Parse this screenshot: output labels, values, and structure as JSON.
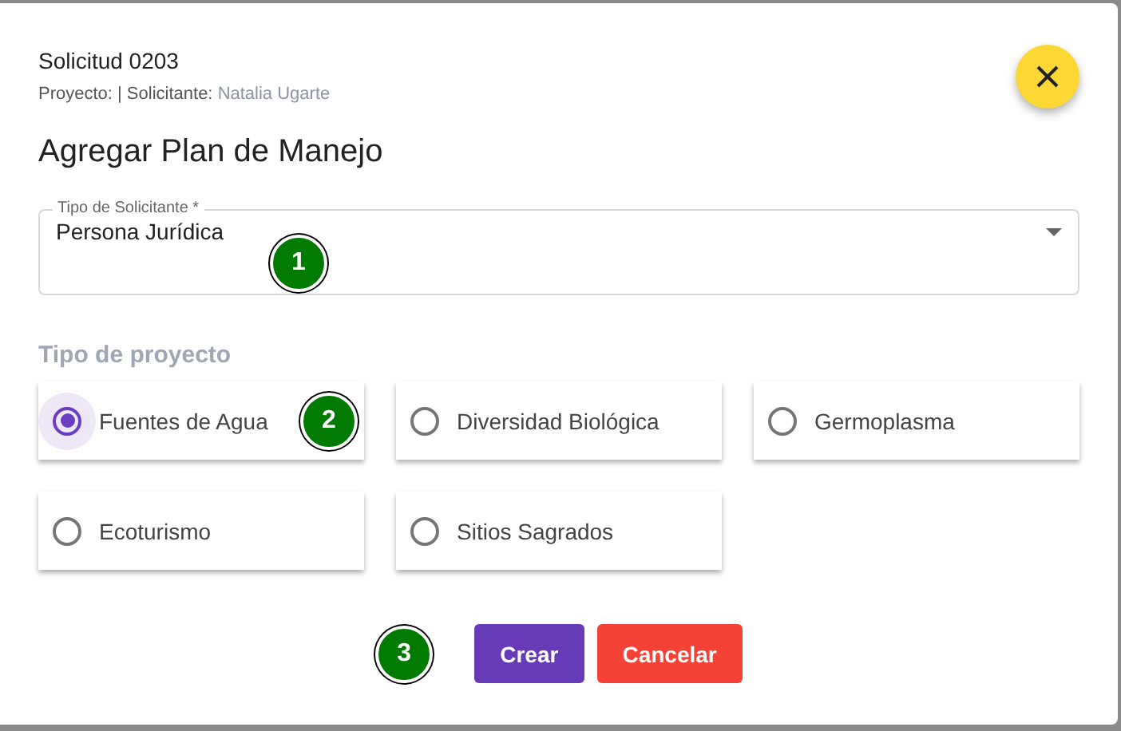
{
  "dialog": {
    "request": "Solicitud 0203",
    "meta_prefix": "Proyecto: | Solicitante:",
    "applicant": "Natalia Ugarte",
    "title": "Agregar Plan de Manejo"
  },
  "select": {
    "label": "Tipo de Solicitante *",
    "value": "Persona Jurídica",
    "badge": "1"
  },
  "project_type": {
    "heading": "Tipo de proyecto",
    "options": [
      {
        "label": "Fuentes de Agua",
        "selected": true,
        "badge": "2"
      },
      {
        "label": "Diversidad Biológica",
        "selected": false
      },
      {
        "label": "Germoplasma",
        "selected": false
      },
      {
        "label": "Ecoturismo",
        "selected": false
      },
      {
        "label": "Sitios Sagrados",
        "selected": false
      }
    ]
  },
  "actions": {
    "badge": "3",
    "buttons": [
      {
        "label": "Crear",
        "kind": "primary"
      },
      {
        "label": "Cancelar",
        "kind": "danger"
      }
    ]
  }
}
